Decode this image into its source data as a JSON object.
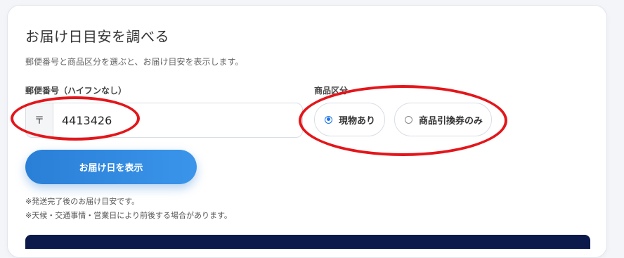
{
  "header": {
    "title": "お届け日目安を調べる",
    "description": "郵便番号と商品区分を選ぶと、お届け目安を表示します。"
  },
  "postal": {
    "label": "郵便番号（ハイフンなし）",
    "prefix_symbol": "〒",
    "value": "4413426"
  },
  "category": {
    "label": "商品区分",
    "options": [
      {
        "label": "現物あり",
        "checked": true
      },
      {
        "label": "商品引換券のみ",
        "checked": false
      }
    ]
  },
  "submit": {
    "label": "お届け日を表示"
  },
  "notes": [
    "※発送完了後のお届け目安です。",
    "※天候・交通事情・営業日により前後する場合があります。"
  ],
  "colors": {
    "accent": "#2a7fd6",
    "annotation": "#e3161b",
    "result_bar": "#0b1a4a"
  }
}
